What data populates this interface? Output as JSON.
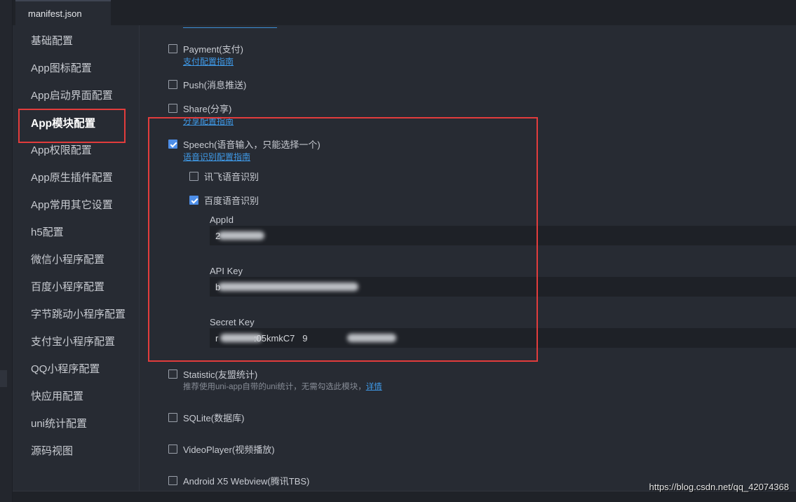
{
  "editor": {
    "tab_title": "manifest.json"
  },
  "sidebar": {
    "items": [
      {
        "label": "基础配置"
      },
      {
        "label": "App图标配置"
      },
      {
        "label": "App启动界面配置"
      },
      {
        "label": "App模块配置"
      },
      {
        "label": "App权限配置"
      },
      {
        "label": "App原生插件配置"
      },
      {
        "label": "App常用其它设置"
      },
      {
        "label": "h5配置"
      },
      {
        "label": "微信小程序配置"
      },
      {
        "label": "百度小程序配置"
      },
      {
        "label": "字节跳动小程序配置"
      },
      {
        "label": "支付宝小程序配置"
      },
      {
        "label": "QQ小程序配置"
      },
      {
        "label": "快应用配置"
      },
      {
        "label": "uni统计配置"
      },
      {
        "label": "源码视图"
      }
    ],
    "active_index": 3
  },
  "modules": {
    "payment": {
      "label": "Payment(支付)",
      "checked": false,
      "link": "支付配置指南"
    },
    "push": {
      "label": "Push(消息推送)",
      "checked": false
    },
    "share": {
      "label": "Share(分享)",
      "checked": false,
      "link": "分享配置指南"
    },
    "speech": {
      "label": "Speech(语音输入，只能选择一个)",
      "checked": true,
      "link": "语音识别配置指南",
      "providers": {
        "xunfei": {
          "label": "讯飞语音识别",
          "checked": false
        },
        "baidu": {
          "label": "百度语音识别",
          "checked": true
        }
      },
      "fields": {
        "appid": {
          "label": "AppId",
          "value": "2"
        },
        "apikey": {
          "label": "API Key",
          "value": "b"
        },
        "secretkey": {
          "label": "Secret Key",
          "value": "r              :05kmkC7   9"
        }
      }
    },
    "statistic": {
      "label": "Statistic(友盟统计)",
      "checked": false,
      "hint": "推荐使用uni-app自带的uni统计，无需勾选此模块，",
      "hint_link": "详情"
    },
    "sqlite": {
      "label": "SQLite(数据库)",
      "checked": false
    },
    "videoplayer": {
      "label": "VideoPlayer(视频播放)",
      "checked": false
    },
    "x5webview": {
      "label": "Android X5 Webview(腾讯TBS)",
      "checked": false
    }
  },
  "watermark": "https://blog.csdn.net/qq_42074368",
  "colors": {
    "background": "#272b33",
    "accent_blue": "#4d8ee8",
    "link_blue": "#3f9ae8",
    "highlight_red": "#e23c3c"
  }
}
